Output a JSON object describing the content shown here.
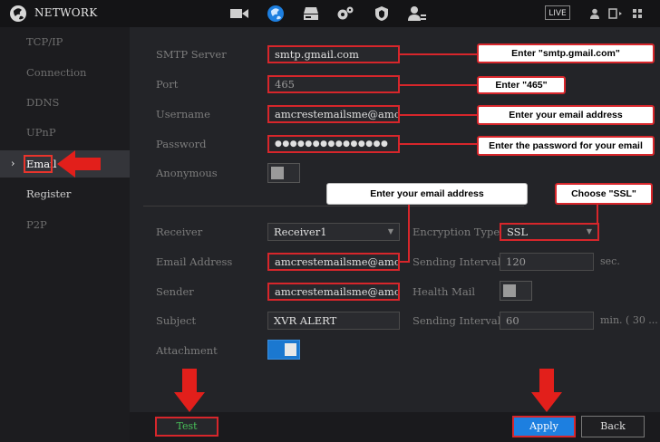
{
  "app": {
    "title": "NETWORK",
    "live_label": "LIVE"
  },
  "top_icons": [
    "camera-icon",
    "network-globe-icon",
    "storage-icon",
    "settings-gears-icon",
    "security-shield-icon",
    "account-icon"
  ],
  "top_right_icons": [
    "user-icon",
    "logout-icon",
    "grid-icon"
  ],
  "sidebar": {
    "items": [
      {
        "label": "TCP/IP"
      },
      {
        "label": "Connection"
      },
      {
        "label": "DDNS"
      },
      {
        "label": "UPnP"
      },
      {
        "label": "Email"
      },
      {
        "label": "Register"
      },
      {
        "label": "P2P"
      }
    ]
  },
  "form": {
    "smtp_server": {
      "label": "SMTP Server",
      "value": "smtp.gmail.com"
    },
    "port": {
      "label": "Port",
      "value": "465"
    },
    "username": {
      "label": "Username",
      "value": "amcrestemailsme@amcre..."
    },
    "password": {
      "label": "Password",
      "value": "●●●●●●●●●●●●●●●"
    },
    "anonymous": {
      "label": "Anonymous",
      "on": false
    },
    "receiver": {
      "label": "Receiver",
      "value": "Receiver1"
    },
    "encryption_type": {
      "label": "Encryption Type",
      "value": "SSL"
    },
    "email_address": {
      "label": "Email Address",
      "value": "amcrestemailsme@amcre..."
    },
    "sending_interval": {
      "label": "Sending Interval",
      "value": "120",
      "unit": "sec."
    },
    "sender": {
      "label": "Sender",
      "value": "amcrestemailsme@amcre..."
    },
    "health_mail": {
      "label": "Health Mail",
      "on": false
    },
    "subject": {
      "label": "Subject",
      "value": "XVR ALERT"
    },
    "sending_interval_2": {
      "label": "Sending Interval",
      "value": "60",
      "unit": "min. ( 30 ..."
    },
    "attachment": {
      "label": "Attachment",
      "on": true
    }
  },
  "buttons": {
    "test": "Test",
    "apply": "Apply",
    "back": "Back"
  },
  "callouts": {
    "smtp": "Enter \"smtp.gmail.com\"",
    "port": "Enter \"465\"",
    "username": "Enter your email address",
    "password": "Enter the password for your email",
    "email_address": "Enter your email address",
    "ssl": "Choose \"SSL\""
  },
  "colors": {
    "highlight_red": "#d7262b",
    "accent_blue": "#1d7fe0",
    "test_green": "#49c25a"
  }
}
